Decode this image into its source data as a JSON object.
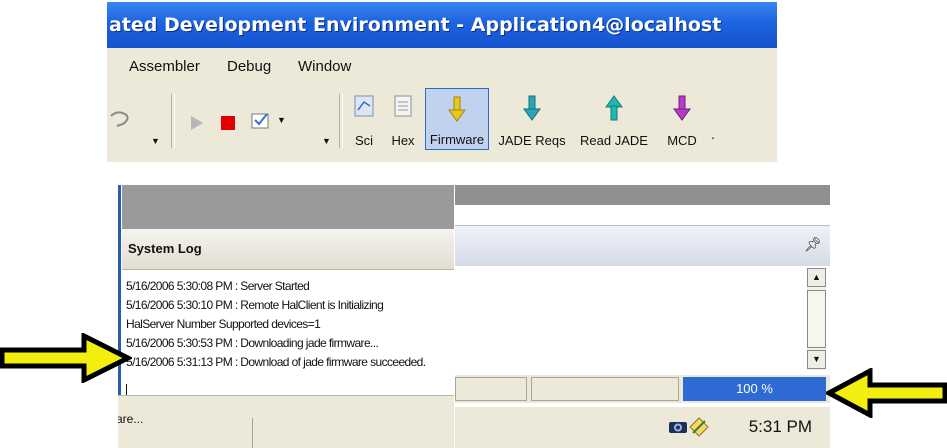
{
  "ide": {
    "title": "ated Development Environment  - Application4@localhost",
    "menu": [
      "Assembler",
      "Debug",
      "Window"
    ],
    "toolbar_buttons": [
      {
        "label": "Sci",
        "icon": "sci-icon"
      },
      {
        "label": "Hex",
        "icon": "hex-icon"
      },
      {
        "label": "Firmware",
        "icon": "firmware-arrow-icon",
        "color": "#e8c81a",
        "active": true
      },
      {
        "label": "JADE Reqs",
        "icon": "jade-reqs-arrow-icon",
        "color": "#2aa5b8"
      },
      {
        "label": "Read JADE",
        "icon": "read-jade-arrow-icon",
        "color": "#22b7b0"
      },
      {
        "label": "MCD",
        "icon": "mcd-arrow-icon",
        "color": "#b53cc4"
      }
    ],
    "toolbar_trailing": "."
  },
  "system_log": {
    "title": "System Log",
    "lines": [
      "5/16/2006 5:30:08 PM : Server Started",
      "5/16/2006 5:30:10 PM : Remote HalClient is Initializing",
      "HalServer Number Supported devices=1",
      "5/16/2006 5:30:53 PM : Downloading jade firmware...",
      "5/16/2006 5:31:13 PM : Download of jade firmware succeeded."
    ],
    "status_text": "vare..."
  },
  "right_panel": {
    "progress": {
      "value": 1.0,
      "label": "100 %",
      "color": "#1f5ec8"
    },
    "tray_time": "5:31 PM"
  },
  "colors": {
    "arrow_fill": "#f2ee10",
    "arrow_outline": "#000000",
    "titlebar": "#1c63e0"
  }
}
